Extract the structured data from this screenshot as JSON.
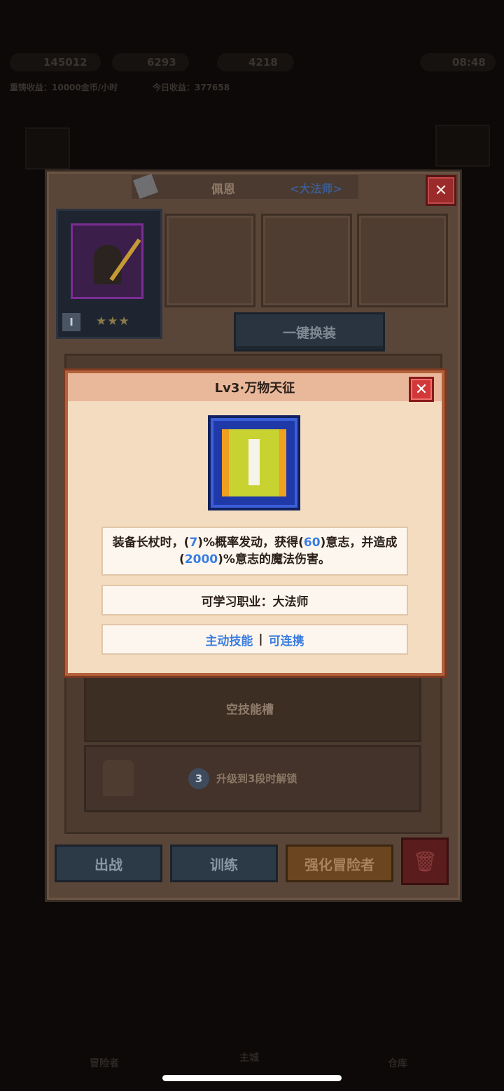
{
  "hud": {
    "value1": "145012",
    "value2": "6293",
    "value3": "4218",
    "time": "08:48",
    "sub_left": "重铸收益：10000金币/小时",
    "sub_right": "今日收益：377658"
  },
  "hero": {
    "name": "佩恩",
    "job": "<大法师>",
    "rank_badge": "I",
    "stars": "★★★"
  },
  "buttons": {
    "one_key_equip": "一键换装",
    "deploy": "出战",
    "train": "训练",
    "enhance": "强化冒险者",
    "close": "✕",
    "trash": "🗑"
  },
  "skill_slots": {
    "empty_label": "空技能槽",
    "locked_level": "3",
    "locked_label": "升级到3段时解锁"
  },
  "popup": {
    "title": "Lv3·万物天征",
    "desc_part1": "装备长杖时，(",
    "desc_val1": "7",
    "desc_part2": ")%概率发动，获得(",
    "desc_val2": "60",
    "desc_part3": ")意志，并造成(",
    "desc_val3": "2000",
    "desc_part4": ")%意志的魔法伤害。",
    "learnable": "可学习职业：大法师",
    "tag1": "主动技能",
    "separator": "|",
    "tag2": "可连携"
  },
  "bottom_nav": {
    "item1": "冒险者",
    "item2": "主城",
    "item3": "仓库"
  },
  "colors": {
    "popup_bg": "#f3dcc0",
    "popup_header": "#e9b79a",
    "accent_blue": "#3b7de0",
    "close_red": "#d33838",
    "enhance_orange": "#b8742e"
  }
}
